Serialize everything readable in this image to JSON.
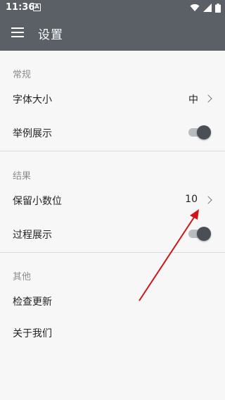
{
  "status_bar": {
    "time": "11:36",
    "notification_icon": "A"
  },
  "app_bar": {
    "title": "设置",
    "menu_icon": "menu-icon"
  },
  "sections": {
    "general": {
      "header": "常规",
      "font_size": {
        "label": "字体大小",
        "value": "中"
      },
      "example_display": {
        "label": "举例展示",
        "toggle_on": true
      }
    },
    "result": {
      "header": "结果",
      "decimal_places": {
        "label": "保留小数位",
        "value": "10"
      },
      "process_display": {
        "label": "过程展示",
        "toggle_on": true
      }
    },
    "other": {
      "header": "其他",
      "check_update": {
        "label": "检查更新"
      },
      "about_us": {
        "label": "关于我们"
      }
    }
  },
  "annotation": {
    "color": "#d0141a"
  },
  "colors": {
    "app_bar": "#5b5f66",
    "toggle_thumb": "#4a4f57",
    "toggle_track": "#b9bcc1",
    "background": "#f7f7f7"
  }
}
